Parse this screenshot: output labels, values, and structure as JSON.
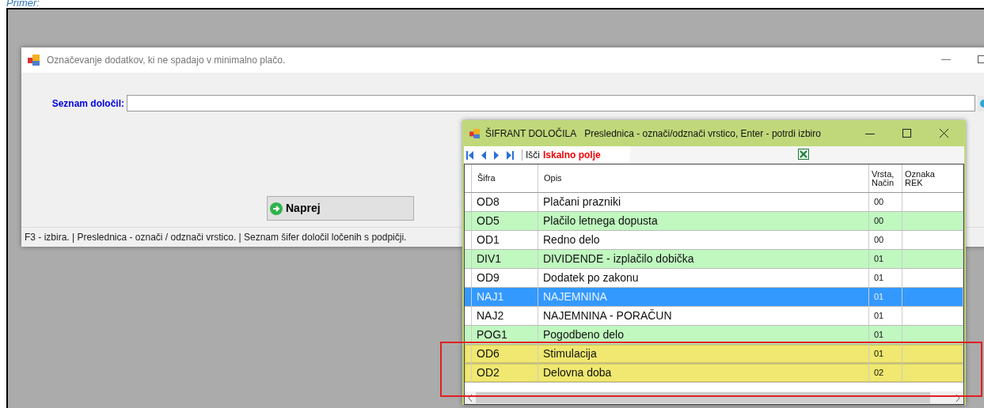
{
  "heading": "Primer:",
  "main_window": {
    "title": "Označevanje dodatkov, ki ne spadajo v minimalno plačo.",
    "field_label": "Seznam določil:",
    "button": "Naprej",
    "status_bar": "F3 - izbira. | Preslednica - označi / odznači vrstico. | Seznam šifer določil ločenih s podpičji."
  },
  "dialog": {
    "title": "ŠIFRANT DOLOČILA",
    "hint": "Preslednica - označi/odznači vrstico, Enter - potrdi izbiro",
    "search_label": "Išči",
    "search_field": "Iskalno polje",
    "columns": [
      {
        "label": "Šifra"
      },
      {
        "label": "Opis"
      },
      {
        "label": "Vrsta, Način"
      },
      {
        "label": "Oznaka REK"
      }
    ],
    "rows": [
      {
        "code": "OD8",
        "description": "Plačani prazniki",
        "type": "00",
        "color": "#ffffff",
        "selected": false,
        "highlighted": false
      },
      {
        "code": "OD5",
        "description": "Plačilo letnega dopusta",
        "type": "00",
        "color": "#c0f8c0",
        "selected": false,
        "highlighted": false
      },
      {
        "code": "OD1",
        "description": "Redno delo",
        "type": "00",
        "color": "#ffffff",
        "selected": false,
        "highlighted": false
      },
      {
        "code": "DIV1",
        "description": "DIVIDENDE - izplačilo dobička",
        "type": "01",
        "color": "#c0f8c0",
        "selected": false,
        "highlighted": false
      },
      {
        "code": "OD9",
        "description": "Dodatek po zakonu",
        "type": "01",
        "color": "#ffffff",
        "selected": false,
        "highlighted": false
      },
      {
        "code": "NAJ1",
        "description": "NAJEMNINA",
        "type": "01",
        "selected": true,
        "highlighted": false
      },
      {
        "code": "NAJ2",
        "description": "NAJEMNINA - PORAČUN",
        "type": "01",
        "color": "#ffffff",
        "selected": false,
        "highlighted": false
      },
      {
        "code": "POG1",
        "description": "Pogodbeno delo",
        "type": "01",
        "color": "#c0f8c0",
        "selected": false,
        "highlighted": false
      },
      {
        "code": "OD6",
        "description": "Stimulacija",
        "type": "01",
        "color": "#f0e870",
        "selected": false,
        "highlighted": true
      },
      {
        "code": "OD2",
        "description": "Delovna doba",
        "type": "02",
        "color": "#f0e870",
        "selected": false,
        "highlighted": true
      }
    ]
  }
}
